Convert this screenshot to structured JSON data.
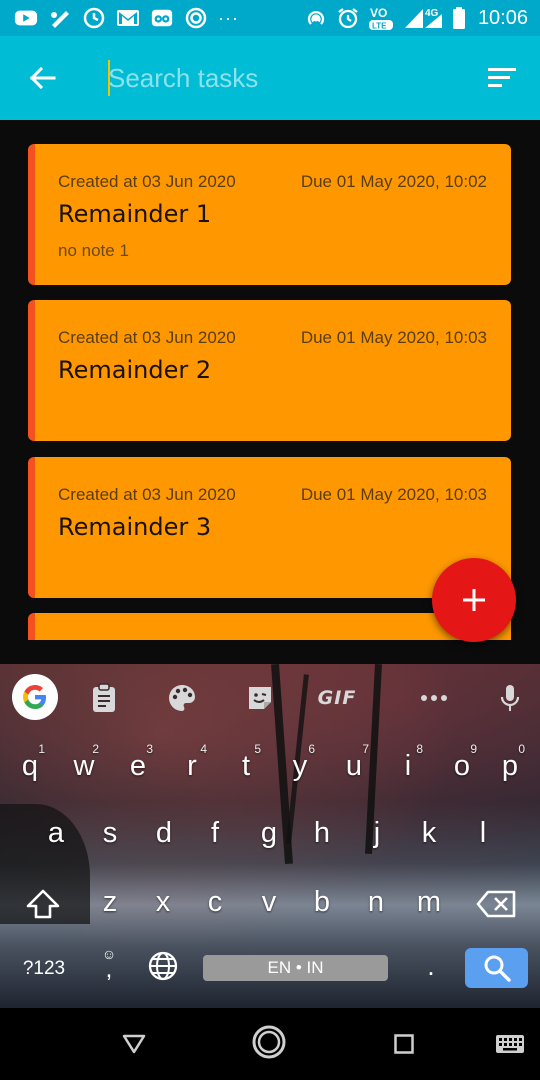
{
  "status_bar": {
    "time": "10:06",
    "network_label": "4G",
    "volte_label": "VO LTE",
    "overflow": "···",
    "left_icons": [
      "youtube-icon",
      "pen-icon",
      "clock-icon",
      "gmail-icon",
      "tripadvisor-icon",
      "swirl-icon"
    ],
    "right_icons": [
      "hotspot-icon",
      "alarm-icon",
      "volte-icon",
      "signal-icon",
      "battery-icon"
    ]
  },
  "app_bar": {
    "search_placeholder": "Search tasks",
    "back_icon": "arrow-left-icon",
    "sort_icon": "sort-icon",
    "color": "#00bcd4"
  },
  "tasks": [
    {
      "created": "Created at 03 Jun 2020",
      "due": "Due 01 May 2020, 10:02",
      "title": "Remainder 1",
      "note": "no note 1"
    },
    {
      "created": "Created at 03 Jun 2020",
      "due": "Due 01 May 2020, 10:03",
      "title": "Remainder 2",
      "note": ""
    },
    {
      "created": "Created at 03 Jun 2020",
      "due": "Due 01 May 2020, 10:03",
      "title": "Remainder 3",
      "note": ""
    }
  ],
  "card_colors": {
    "background": "#ff9800",
    "accent": "#f4511e"
  },
  "fab": {
    "icon": "plus-icon",
    "color": "#e51616"
  },
  "keyboard": {
    "toolbar": {
      "gif_label": "GIF",
      "icons": [
        "google-icon",
        "clipboard-icon",
        "palette-icon",
        "sticker-icon",
        "gif-icon",
        "more-icon",
        "mic-icon"
      ]
    },
    "row1": [
      "q",
      "w",
      "e",
      "r",
      "t",
      "y",
      "u",
      "i",
      "o",
      "p"
    ],
    "row1_hints": [
      "1",
      "2",
      "3",
      "4",
      "5",
      "6",
      "7",
      "8",
      "9",
      "0"
    ],
    "row2": [
      "a",
      "s",
      "d",
      "f",
      "g",
      "h",
      "j",
      "k",
      "l"
    ],
    "row3": [
      "z",
      "x",
      "c",
      "v",
      "b",
      "n",
      "m"
    ],
    "symbols_key": "?123",
    "comma_key": ",",
    "period_key": ".",
    "space_label": "EN • IN",
    "search_key_color": "#5b9ff0"
  },
  "nav_bar": {
    "icons": [
      "back-triangle-icon",
      "home-circle-icon",
      "recents-square-icon",
      "keyboard-switch-icon"
    ]
  }
}
